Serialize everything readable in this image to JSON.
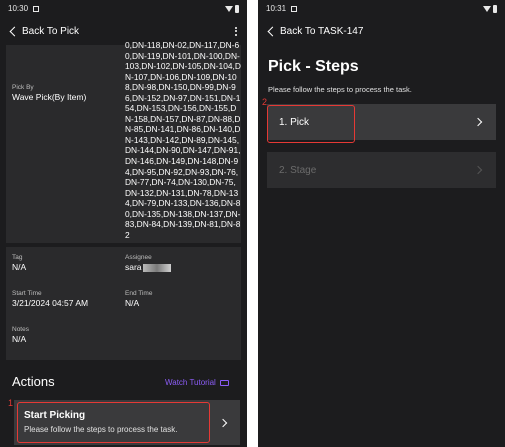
{
  "left": {
    "status_time": "10:30",
    "back_label": "Back To Pick",
    "pick_by_label": "Pick By",
    "pick_by_value": "Wave Pick(By Item)",
    "dn_list": "0,DN-118,DN-02,DN-117,DN-60,DN-119,DN-101,DN-100,DN-103,DN-102,DN-105,DN-104,DN-107,DN-106,DN-109,DN-108,DN-98,DN-150,DN-99,DN-96,DN-152,DN-97,DN-151,DN-154,DN-153,DN-156,DN-155,DN-158,DN-157,DN-87,DN-88,DN-85,DN-141,DN-86,DN-140,DN-143,DN-142,DN-89,DN-145,DN-144,DN-90,DN-147,DN-91,DN-146,DN-149,DN-148,DN-94,DN-95,DN-92,DN-93,DN-76,DN-77,DN-74,DN-130,DN-75,DN-132,DN-131,DN-78,DN-134,DN-79,DN-133,DN-136,DN-80,DN-135,DN-138,DN-137,DN-83,DN-84,DN-139,DN-81,DN-82",
    "tag_label": "Tag",
    "tag_value": "N/A",
    "assignee_label": "Assignee",
    "assignee_value": "sara",
    "start_time_label": "Start Time",
    "start_time_value": "3/21/2024 04:57 AM",
    "end_time_label": "End Time",
    "end_time_value": "N/A",
    "notes_label": "Notes",
    "notes_value": "N/A",
    "actions_title": "Actions",
    "watch_tutorial": "Watch Tutorial",
    "start_picking_title": "Start Picking",
    "start_picking_sub": "Please follow the steps to process the task.",
    "annotation_number": "1"
  },
  "right": {
    "status_time": "10:31",
    "back_label": "Back To TASK-147",
    "title": "Pick - Steps",
    "subtitle": "Please follow the steps to process the task.",
    "steps": [
      {
        "label": "1. Pick"
      },
      {
        "label": "2. Stage"
      }
    ],
    "annotation_number": "2"
  },
  "colors": {
    "background": "#1c1c1e",
    "card": "#2a2a2c",
    "action_card": "#3a3a3c",
    "accent_purple": "#8b5cf6",
    "annotation_red": "#e53935"
  }
}
